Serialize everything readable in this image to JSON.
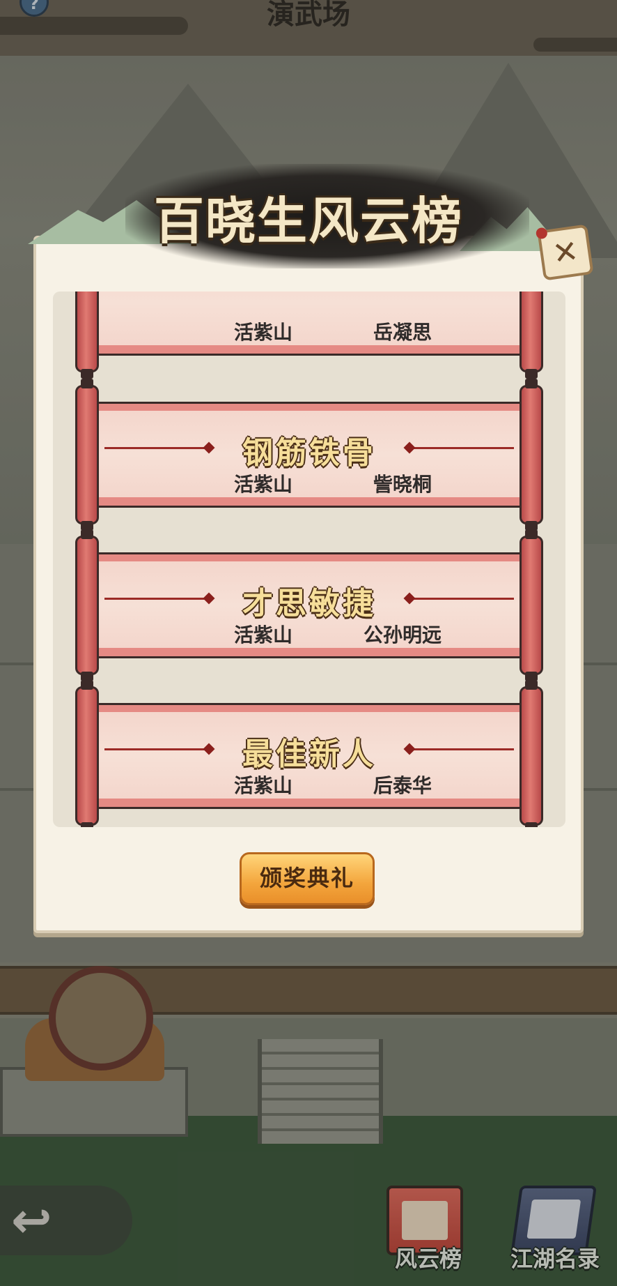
{
  "screen": {
    "title": "演武场"
  },
  "modal": {
    "title": "百晓生风云榜",
    "ceremony_button": "颁奖典礼",
    "awards": [
      {
        "award": "",
        "sect": "活紫山",
        "winner": "岳凝思"
      },
      {
        "award": "钢筋铁骨",
        "sect": "活紫山",
        "winner": "訾晓桐"
      },
      {
        "award": "才思敏捷",
        "sect": "活紫山",
        "winner": "公孙明远"
      },
      {
        "award": "最佳新人",
        "sect": "活紫山",
        "winner": "后泰华"
      }
    ]
  },
  "bottom_nav": {
    "rankings_label": "风云榜",
    "roster_label": "江湖名录"
  },
  "icons": [
    "help-icon",
    "close-icon",
    "back-arrow-icon",
    "scroll-book-icon",
    "roster-book-icon"
  ],
  "colors": {
    "scroll_red": "#e07a72",
    "award_gold": "#f6de9a",
    "button_orange": "#f3a53c",
    "modal_paper": "#f7f2e6"
  }
}
